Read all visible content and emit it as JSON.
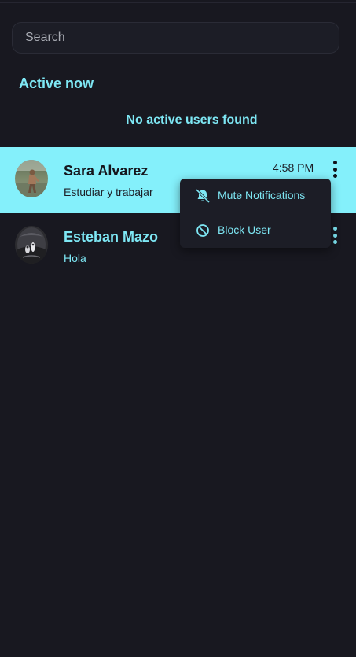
{
  "search": {
    "placeholder": "Search"
  },
  "active_section": {
    "title": "Active now",
    "empty_message": "No active users found"
  },
  "chats": [
    {
      "name": "Sara Alvarez",
      "preview": "Estudiar y trabajar",
      "time": "4:58 PM",
      "selected": true
    },
    {
      "name": "Esteban Mazo",
      "preview": "Hola",
      "time": "",
      "selected": false
    }
  ],
  "menu": {
    "items": [
      {
        "label": "Mute Notifications",
        "icon": "bell-off-icon"
      },
      {
        "label": "Block User",
        "icon": "block-icon"
      }
    ]
  },
  "colors": {
    "background": "#181820",
    "accent": "#7ee7f4",
    "selected_row": "#84f0fb",
    "menu_background": "#1c1d26"
  }
}
